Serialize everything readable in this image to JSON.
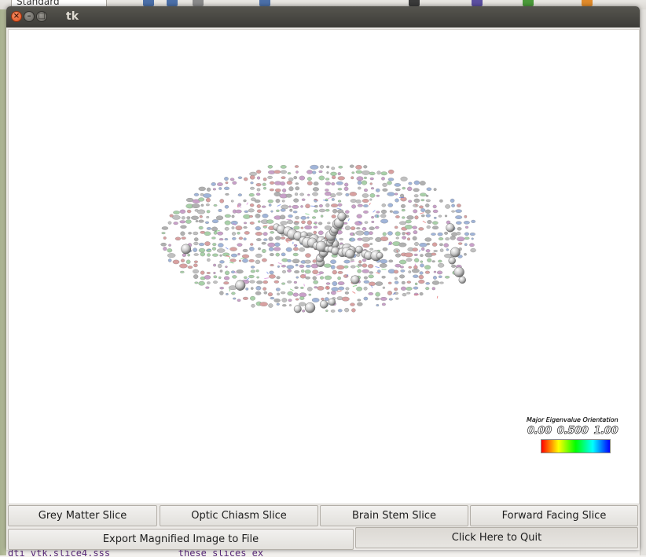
{
  "background": {
    "combo_text": "Standard",
    "code_line": "dti_vtk.slice4.sss            these slices ex"
  },
  "window": {
    "title": "tk"
  },
  "legend": {
    "title": "Major Eigenvalue Orientation",
    "ticks": [
      "0.00",
      "0.500",
      "1.00"
    ],
    "gradient_colors": [
      "#ff0000",
      "#ffff00",
      "#00ff00",
      "#00ffff",
      "#0000ff"
    ]
  },
  "buttons": {
    "row1": [
      {
        "label": "Grey Matter Slice"
      },
      {
        "label": "Optic Chiasm Slice"
      },
      {
        "label": "Brain Stem Slice"
      },
      {
        "label": "Forward Facing Slice"
      }
    ],
    "export_label": "Export Magnified Image to File",
    "quit_label": "Click Here to Quit"
  }
}
